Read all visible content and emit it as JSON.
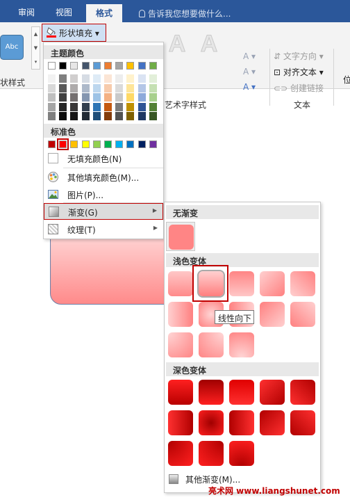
{
  "tabs": [
    {
      "label": "审阅"
    },
    {
      "label": "视图"
    },
    {
      "label": "格式"
    }
  ],
  "tell_me": "告诉我您想要做什么...",
  "ribbon": {
    "style_thumb": "Abc",
    "shape_styles_label": "状样式",
    "shape_fill_button": "形状填充",
    "wordart_styles_label": "艺术字样式",
    "text_fill_letter": "A",
    "text_direction": "文字方向",
    "align_text": "对齐文本",
    "create_link": "创建链接",
    "text_group_label": "文本",
    "position_label": "位"
  },
  "fill_menu": {
    "theme_colors_heading": "主题颜色",
    "standard_colors_heading": "标准色",
    "no_fill": "无填充颜色(N)",
    "more_fill_colors": "其他填充颜色(M)...",
    "picture": "图片(P)...",
    "gradient": "渐变(G)",
    "texture": "纹理(T)",
    "theme_top": [
      "#ffffff",
      "#000000",
      "#e7e6e6",
      "#44546a",
      "#5b9bd5",
      "#ed7d31",
      "#a5a5a5",
      "#ffc000",
      "#4472c4",
      "#70ad47"
    ],
    "theme_shades": [
      [
        "#f2f2f2",
        "#7f7f7f",
        "#d0cece",
        "#d6dce4",
        "#deebf6",
        "#fbe5d5",
        "#ededed",
        "#fff2cc",
        "#dae3f3",
        "#e2efd9"
      ],
      [
        "#d8d8d8",
        "#595959",
        "#aeabab",
        "#adb9ca",
        "#bdd7ee",
        "#f7cbac",
        "#dbdbdb",
        "#fee599",
        "#b4c6e7",
        "#c5e0b3"
      ],
      [
        "#bfbfbf",
        "#3f3f3f",
        "#757070",
        "#8496b0",
        "#9dc3e6",
        "#f4b183",
        "#c9c9c9",
        "#ffd965",
        "#8eaadb",
        "#a8d08d"
      ],
      [
        "#a5a5a5",
        "#262626",
        "#3a3838",
        "#323f4f",
        "#2e75b5",
        "#c55a11",
        "#7b7b7b",
        "#bf9000",
        "#2f5496",
        "#538135"
      ],
      [
        "#7f7f7f",
        "#0c0c0c",
        "#171616",
        "#222a35",
        "#1e4e79",
        "#833c0b",
        "#525252",
        "#7f6000",
        "#1f3864",
        "#375623"
      ]
    ],
    "standard": [
      "#c00000",
      "#ff0000",
      "#ffc000",
      "#ffff00",
      "#92d050",
      "#00b050",
      "#00b0f0",
      "#0070c0",
      "#002060",
      "#7030a0"
    ]
  },
  "gradient_menu": {
    "no_gradient_heading": "无渐变",
    "light_variations_heading": "浅色变体",
    "dark_variations_heading": "深色变体",
    "tooltip": "线性向下",
    "more_gradients": "其他渐变(M)..."
  },
  "watermark": "亮术网 www.liangshunet.com"
}
